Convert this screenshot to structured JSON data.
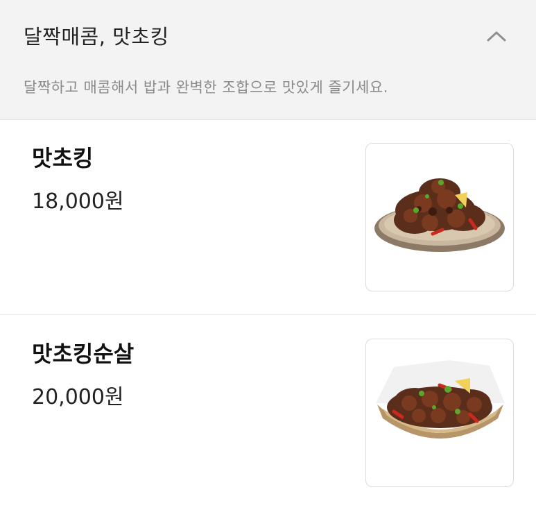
{
  "section": {
    "title": "달짝매콤, 맛초킹",
    "description": "달짝하고 매콤해서 밥과 완벽한 조합으로 맛있게 즐기세요.",
    "collapse_icon": "chevron-up-icon"
  },
  "menu_items": [
    {
      "name": "맛초킹",
      "price": "18,000원",
      "image": "chicken-plate-image"
    },
    {
      "name": "맛초킹순살",
      "price": "20,000원",
      "image": "boneless-chicken-basket-image"
    }
  ],
  "colors": {
    "header_bg": "#f3f3f3",
    "title_text": "#222222",
    "desc_text": "#8a8a8a",
    "divider": "#e2e2e2"
  }
}
